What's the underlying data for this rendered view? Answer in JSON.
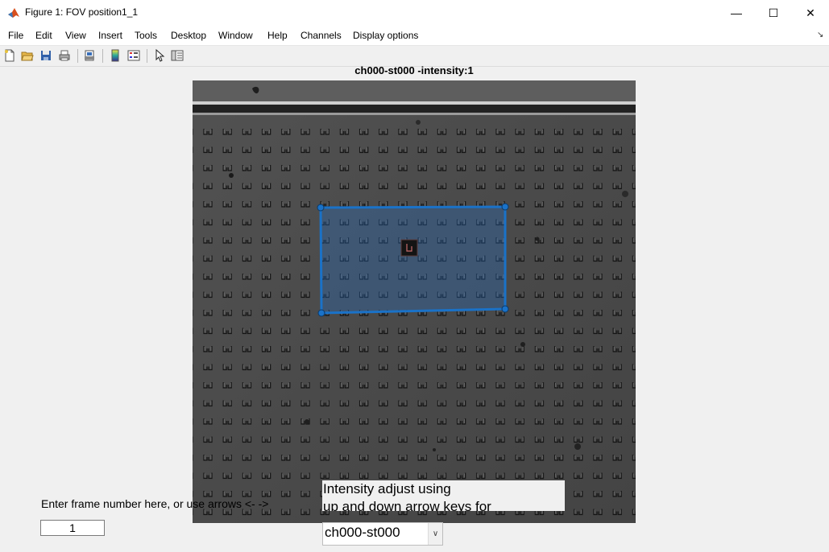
{
  "window": {
    "title": "Figure 1: FOV position1_1",
    "minimize_glyph": "—",
    "maximize_glyph": "☐",
    "close_glyph": "✕"
  },
  "menubar": {
    "items": [
      "File",
      "Edit",
      "View",
      "Insert",
      "Tools",
      "Desktop",
      "Window",
      "Help",
      "Channels",
      "Display options"
    ],
    "dock_glyph": "↘"
  },
  "toolbar": {
    "buttons": [
      "new-figure-icon",
      "open-file-icon",
      "save-icon",
      "print-icon",
      "print-preview-icon",
      "colorbar-icon",
      "legend-icon",
      "pointer-icon",
      "property-inspector-icon"
    ]
  },
  "axes": {
    "title": "ch000-st000 -intensity:1"
  },
  "controls": {
    "frame_label": "Enter frame number here, or use arrows <- ->",
    "frame_value": "1",
    "intensity_line1": "Intensity adjust using",
    "intensity_line2": "up and down arrow keys for",
    "channel_selected": "ch000-st000",
    "dropdown_arrow": "∨"
  },
  "colors": {
    "roi": "#1a72c8",
    "image_background": "#4d4d4d"
  }
}
